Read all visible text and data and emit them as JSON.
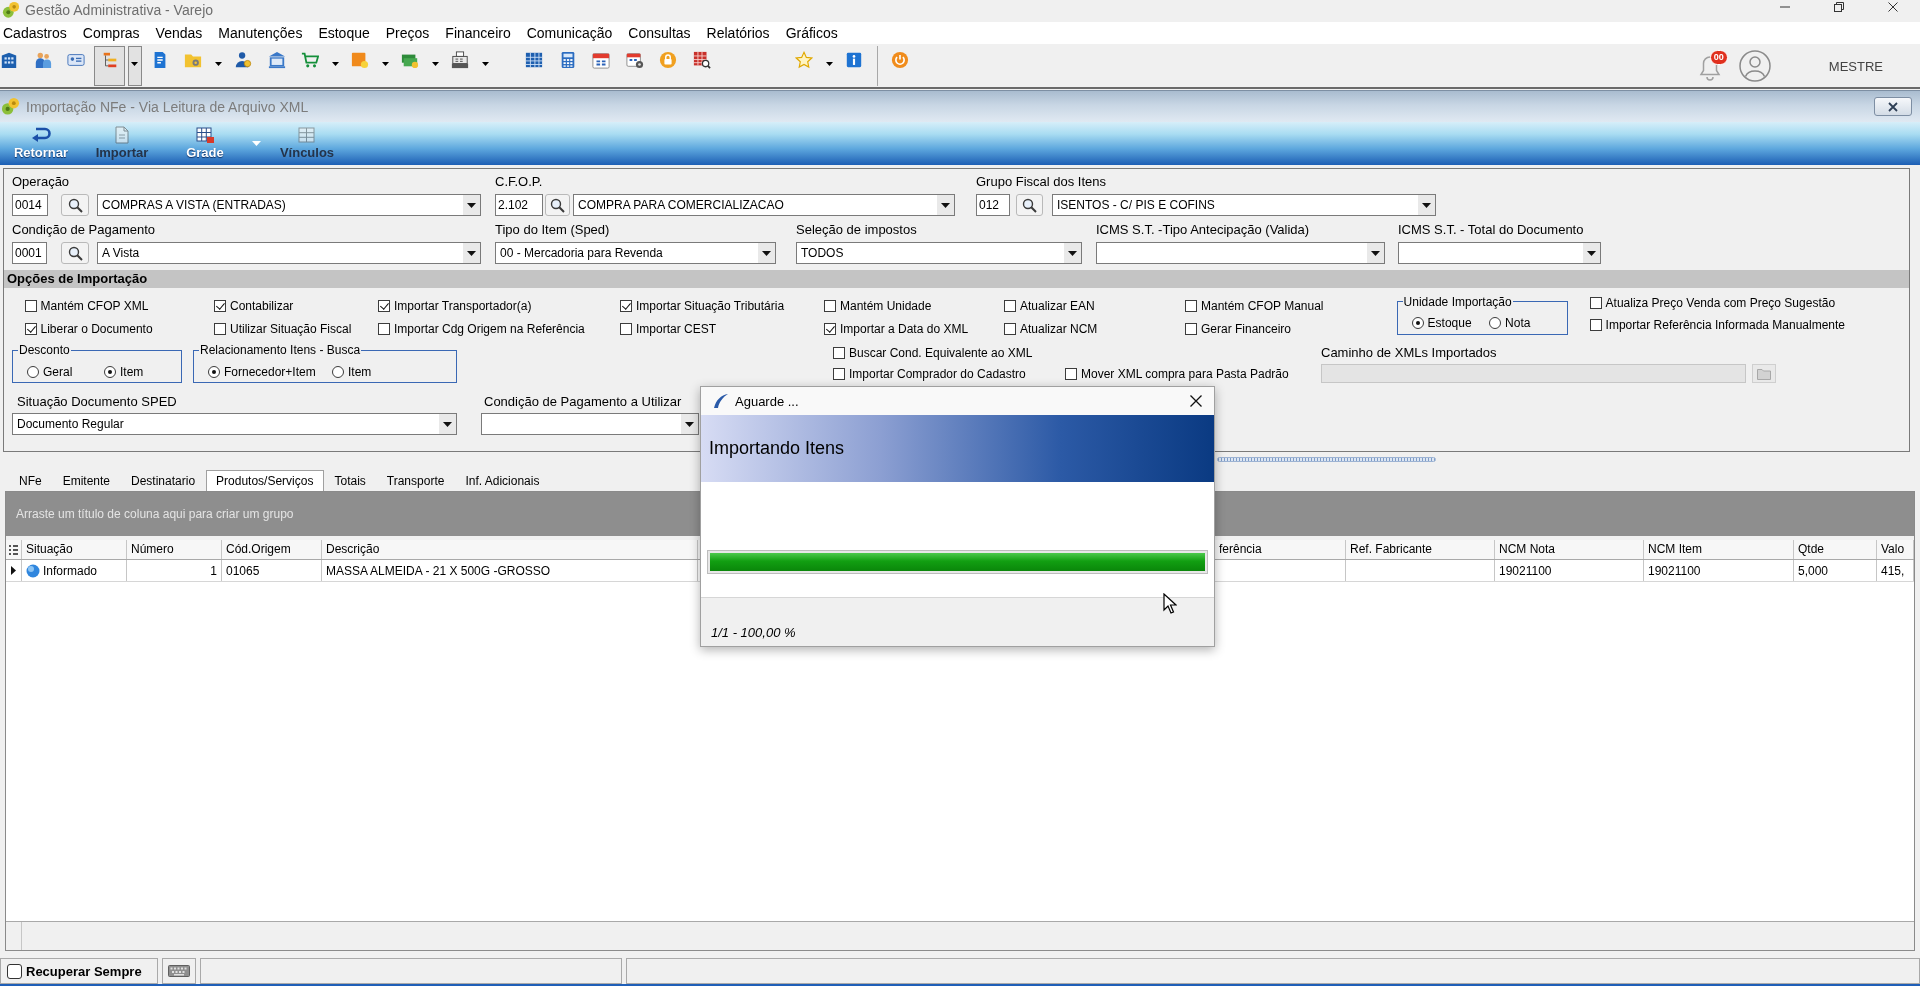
{
  "window": {
    "title": "Gestão Administrativa - Varejo"
  },
  "menu": [
    "Cadastros",
    "Compras",
    "Vendas",
    "Manutenções",
    "Estoque",
    "Preços",
    "Financeiro",
    "Comunicação",
    "Consultas",
    "Relatórios",
    "Gráficos"
  ],
  "toolbar": [
    [
      {
        "pressed": false,
        "dropdown": false
      },
      {
        "pressed": false,
        "dropdown": false
      },
      {
        "pressed": false,
        "dropdown": false
      },
      {
        "pressed": true,
        "dropdown": true
      },
      {
        "pressed": false,
        "dropdown": false
      },
      {
        "pressed": false,
        "dropdown": true
      },
      {
        "pressed": false,
        "dropdown": false
      },
      {
        "pressed": false,
        "dropdown": false
      },
      {
        "pressed": false,
        "dropdown": true
      },
      {
        "pressed": false,
        "dropdown": true
      },
      {
        "pressed": false,
        "dropdown": true
      },
      {
        "pressed": false,
        "dropdown": true
      }
    ],
    [
      {
        "pressed": false,
        "dropdown": false
      },
      {
        "pressed": false,
        "dropdown": false
      },
      {
        "pressed": false,
        "dropdown": false
      },
      {
        "pressed": false,
        "dropdown": false
      },
      {
        "pressed": false,
        "dropdown": false
      },
      {
        "pressed": false,
        "dropdown": false
      }
    ],
    [
      {
        "pressed": false,
        "dropdown": true
      },
      {
        "pressed": false,
        "dropdown": false
      }
    ],
    [
      {
        "pressed": false,
        "dropdown": false
      }
    ]
  ],
  "notifications": {
    "count": "00"
  },
  "user": {
    "name": "MESTRE"
  },
  "document_window": {
    "title": "Importação NFe - Via Leitura de Arquivo XML"
  },
  "ribbon": [
    {
      "label": "Retornar",
      "disabled": false,
      "dropdown": false
    },
    {
      "label": "Importar",
      "disabled": true,
      "dropdown": false
    },
    {
      "label": "Grade",
      "disabled": false,
      "dropdown": true
    },
    {
      "label": "Vínculos",
      "disabled": true,
      "dropdown": false
    }
  ],
  "form": {
    "rows": [
      [
        {
          "kind": "lookup",
          "label": "Operação",
          "code": "0014",
          "value": "COMPRAS A VISTA (ENTRADAS)"
        },
        {
          "kind": "lookup",
          "label": "C.F.O.P.",
          "code": "2.102",
          "value": "COMPRA PARA COMERCIALIZACAO"
        },
        {
          "kind": "lookup",
          "label": "Grupo Fiscal dos Itens",
          "code": "012",
          "value": "ISENTOS - C/ PIS E COFINS"
        }
      ],
      [
        {
          "kind": "lookup",
          "label": "Condição de Pagamento",
          "code": "0001",
          "value": "A Vista"
        },
        {
          "kind": "select",
          "label": "Tipo do Item (Sped)",
          "value": "00 - Mercadoria para Revenda"
        },
        {
          "kind": "select",
          "label": "Seleção de impostos",
          "value": "TODOS"
        },
        {
          "kind": "select",
          "label": "ICMS S.T. -Tipo Antecipação (Valida)"
        },
        {
          "kind": "select",
          "label": "ICMS S.T. - Total do Documento"
        }
      ]
    ]
  },
  "options": {
    "title": "Opções de Importação",
    "columns": [
      [
        {
          "label": "Mantém CFOP XML",
          "checked": false
        },
        {
          "label": "Liberar o Documento",
          "checked": true
        }
      ],
      [
        {
          "label": "Contabilizar",
          "checked": true
        },
        {
          "label": "Utilizar Situação Fiscal",
          "checked": false
        }
      ],
      [
        {
          "label": "Importar Transportador(a)",
          "checked": true
        },
        {
          "label": "Importar Cdg Origem na Referência",
          "checked": false
        }
      ],
      [
        {
          "label": "Importar Situação Tributária",
          "checked": true
        },
        {
          "label": "Importar CEST",
          "checked": false
        }
      ],
      [
        {
          "label": "Mantém Unidade",
          "checked": false
        },
        {
          "label": "Importar a Data do XML",
          "checked": true
        }
      ],
      [
        {
          "label": "Atualizar EAN",
          "checked": false
        },
        {
          "label": "Atualizar NCM",
          "checked": false
        }
      ],
      [
        {
          "label": "Mantém CFOP Manual",
          "checked": false
        },
        {
          "label": "Gerar Financeiro",
          "checked": false
        }
      ]
    ],
    "unidade_importacao": {
      "title": "Unidade Importação",
      "options": [
        {
          "label": "Estoque",
          "selected": true
        },
        {
          "label": "Nota",
          "selected": false
        }
      ]
    },
    "price_options": [
      {
        "label": "Atualiza Preço Venda com Preço Sugestão",
        "checked": false
      },
      {
        "label": "Importar Referência Informada Manualmente",
        "checked": false
      }
    ],
    "desconto": {
      "title": "Desconto",
      "options": [
        {
          "label": "Geral",
          "selected": false
        },
        {
          "label": "Item",
          "selected": true
        }
      ]
    },
    "relacionamento": {
      "title": "Relacionamento Itens - Busca",
      "options": [
        {
          "label": "Fornecedor+Item",
          "selected": true
        },
        {
          "label": "Item",
          "selected": false
        }
      ]
    },
    "more": [
      {
        "label": "Buscar Cond. Equivalente ao XML",
        "checked": false
      },
      {
        "label": "Importar Comprador do Cadastro",
        "checked": false
      }
    ],
    "mover_xml": {
      "label": "Mover XML compra para Pasta Padrão",
      "checked": false
    },
    "caminho": {
      "label": "Caminho de XMLs Importados",
      "disabled": true
    }
  },
  "sped_row": [
    {
      "label": "Situação Documento SPED",
      "value": "Documento Regular"
    },
    {
      "label": "Condição de Pagamento a Utilizar"
    }
  ],
  "tabs": [
    {
      "label": "NFe",
      "selected": false
    },
    {
      "label": "Emitente",
      "selected": false
    },
    {
      "label": "Destinatario",
      "selected": false
    },
    {
      "label": "Produtos/Serviços",
      "selected": true
    },
    {
      "label": "Totais",
      "selected": false
    },
    {
      "label": "Transporte",
      "selected": false
    },
    {
      "label": "Inf. Adicionais",
      "selected": false
    }
  ],
  "grid": {
    "group_hint": "Arraste um título de coluna aqui para criar um grupo",
    "columns": [
      "Situação",
      "Número",
      "Cód.Origem",
      "Descrição",
      "ferência",
      "Ref. Fabricante",
      "NCM Nota",
      "NCM Item",
      "Qtde",
      "Valo"
    ],
    "rows": [
      {
        "selected": true,
        "cells": [
          "Informado",
          "1",
          "01065",
          "MASSA ALMEIDA - 21 X 500G -GROSSO",
          null,
          null,
          "19021100",
          "19021100",
          "5,000",
          "415,"
        ]
      }
    ]
  },
  "status_bar": {
    "recuperar_sempre": {
      "label": "Recuperar Sempre",
      "checked": false
    }
  },
  "dialog": {
    "title": "Aguarde ...",
    "heading": "Importando Itens",
    "level": 1,
    "progress_text": "1/1 - 100,00 %"
  }
}
